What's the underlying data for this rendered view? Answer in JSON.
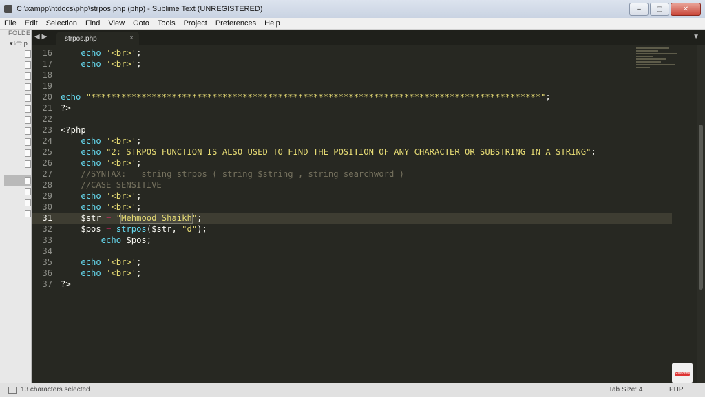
{
  "window": {
    "title": "C:\\xampp\\htdocs\\php\\strpos.php (php) - Sublime Text (UNREGISTERED)",
    "buttons": [
      "–",
      "▢",
      "✕"
    ]
  },
  "menu": [
    "File",
    "Edit",
    "Selection",
    "Find",
    "View",
    "Goto",
    "Tools",
    "Project",
    "Preferences",
    "Help"
  ],
  "sidebar": {
    "header": "FOLDER",
    "root_label": "p"
  },
  "tab": {
    "nav": "◀ ▶",
    "label": "strpos.php",
    "close": "×",
    "dropdown": "▼"
  },
  "editor": {
    "line_numbers": [
      "16",
      "17",
      "18",
      "19",
      "20",
      "21",
      "22",
      "23",
      "24",
      "25",
      "26",
      "27",
      "28",
      "29",
      "30",
      "31",
      "32",
      "33",
      "34",
      "35",
      "36",
      "37"
    ],
    "current_line": "31",
    "lines": [
      [
        "    ",
        "echo",
        " ",
        "'<br>'",
        ";"
      ],
      [
        "    ",
        "echo",
        " ",
        "'<br>'",
        ";"
      ],
      [
        ""
      ],
      [
        ""
      ],
      [
        "echo",
        " ",
        "\"*****************************************************************************************\"",
        ";"
      ],
      [
        "?>"
      ],
      [
        ""
      ],
      [
        "<?php"
      ],
      [
        "    ",
        "echo",
        " ",
        "'<br>'",
        ";"
      ],
      [
        "    ",
        "echo",
        " ",
        "\"2: STRPOS FUNCTION IS ALSO USED TO FIND THE POSITION OF ANY CHARACTER OR SUBSTRING IN A STRING\"",
        ";"
      ],
      [
        "    ",
        "echo",
        " ",
        "'<br>'",
        ";"
      ],
      [
        "    ",
        "//SYNTAX:   string strpos ( string $string , string searchword )"
      ],
      [
        "    ",
        "//CASE SENSITIVE"
      ],
      [
        "    ",
        "echo",
        " ",
        "'<br>'",
        ";"
      ],
      [
        "    ",
        "echo",
        " ",
        "'<br>'",
        ";"
      ],
      [
        "    ",
        "$str",
        " ",
        "=",
        " ",
        "\"",
        "Mehmood Shaikh",
        "\"",
        ";"
      ],
      [
        "    ",
        "$pos",
        " ",
        "=",
        " ",
        "strpos",
        "($str, ",
        "\"d\"",
        ");"
      ],
      [
        "        ",
        "echo",
        " ",
        "$pos",
        ";"
      ],
      [
        ""
      ],
      [
        "    ",
        "echo",
        " ",
        "'<br>'",
        ";"
      ],
      [
        "    ",
        "echo",
        " ",
        "'<br>'",
        ";"
      ],
      [
        "?>"
      ]
    ]
  },
  "badge": {
    "label": "Subscribe"
  },
  "status": {
    "selection": "13 characters selected",
    "tab_size": "Tab Size: 4",
    "syntax": "PHP"
  },
  "colors": {
    "editor_bg": "#272822",
    "keyword": "#66d9ef",
    "string": "#e6db74",
    "comment": "#75715e",
    "operator": "#f92672"
  }
}
